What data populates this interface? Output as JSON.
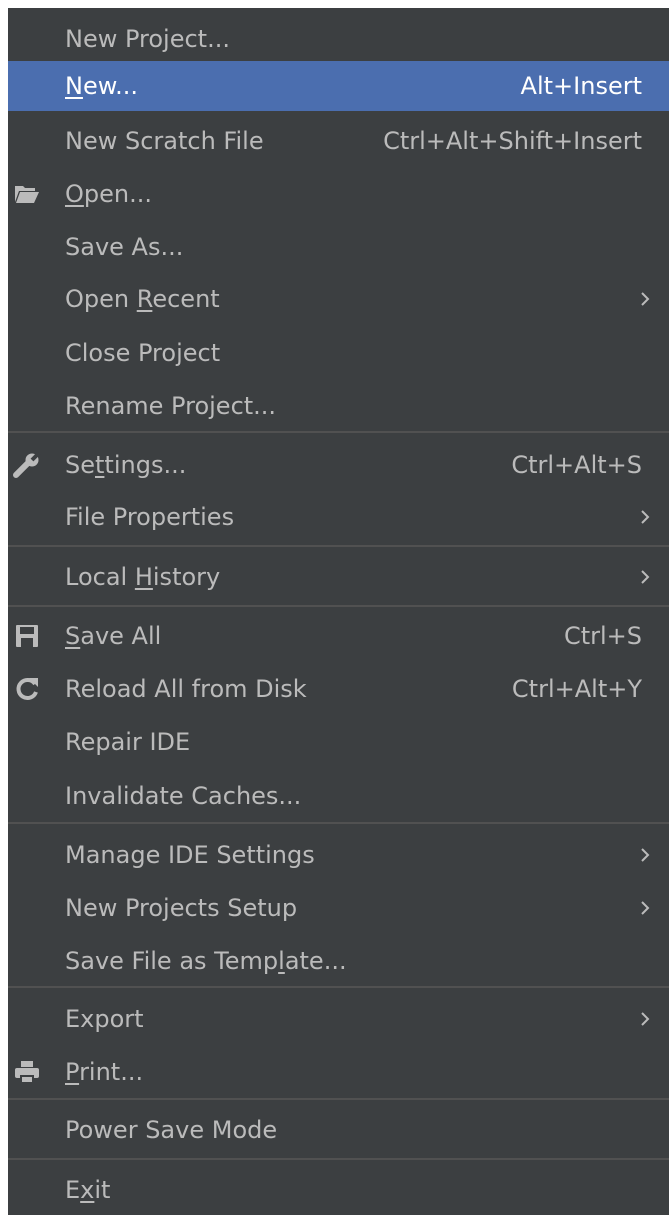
{
  "menu": {
    "items": [
      {
        "id": "new-project",
        "pre": "New Project...",
        "mn": "",
        "post": "",
        "shortcut": "",
        "submenu": false
      },
      {
        "id": "new",
        "pre": "",
        "mn": "N",
        "post": "ew...",
        "shortcut": "Alt+Insert",
        "submenu": false,
        "selected": true
      },
      {
        "id": "new-scratch-file",
        "pre": "New Scratch File",
        "mn": "",
        "post": "",
        "shortcut": "Ctrl+Alt+Shift+Insert",
        "submenu": false
      },
      {
        "id": "open",
        "pre": "",
        "mn": "O",
        "post": "pen...",
        "shortcut": "",
        "submenu": false,
        "icon": "folder-open-icon"
      },
      {
        "id": "save-as",
        "pre": "Save As...",
        "mn": "",
        "post": "",
        "shortcut": "",
        "submenu": false
      },
      {
        "id": "open-recent",
        "pre": "Open ",
        "mn": "R",
        "post": "ecent",
        "shortcut": "",
        "submenu": true
      },
      {
        "id": "close-project",
        "pre": "Close Project",
        "mn": "",
        "post": "",
        "shortcut": "",
        "submenu": false
      },
      {
        "id": "rename-project",
        "pre": "Rename Project...",
        "mn": "",
        "post": "",
        "shortcut": "",
        "submenu": false
      },
      {
        "id": "settings",
        "pre": "Se",
        "mn": "t",
        "post": "tings...",
        "shortcut": "Ctrl+Alt+S",
        "submenu": false,
        "icon": "wrench-icon"
      },
      {
        "id": "file-properties",
        "pre": "File Properties",
        "mn": "",
        "post": "",
        "shortcut": "",
        "submenu": true
      },
      {
        "id": "local-history",
        "pre": "Local ",
        "mn": "H",
        "post": "istory",
        "shortcut": "",
        "submenu": true
      },
      {
        "id": "save-all",
        "pre": "",
        "mn": "S",
        "post": "ave All",
        "shortcut": "Ctrl+S",
        "submenu": false,
        "icon": "floppy-disk-icon"
      },
      {
        "id": "reload-all",
        "pre": "Reload All from Disk",
        "mn": "",
        "post": "",
        "shortcut": "Ctrl+Alt+Y",
        "submenu": false,
        "icon": "refresh-icon"
      },
      {
        "id": "repair-ide",
        "pre": "Repair IDE",
        "mn": "",
        "post": "",
        "shortcut": "",
        "submenu": false
      },
      {
        "id": "invalidate-caches",
        "pre": "Invalidate Caches...",
        "mn": "",
        "post": "",
        "shortcut": "",
        "submenu": false
      },
      {
        "id": "manage-ide-settings",
        "pre": "Manage IDE Settings",
        "mn": "",
        "post": "",
        "shortcut": "",
        "submenu": true
      },
      {
        "id": "new-projects-setup",
        "pre": "New Projects Setup",
        "mn": "",
        "post": "",
        "shortcut": "",
        "submenu": true
      },
      {
        "id": "save-file-as-template",
        "pre": "Save File as Temp",
        "mn": "l",
        "post": "ate...",
        "shortcut": "",
        "submenu": false
      },
      {
        "id": "export",
        "pre": "Export",
        "mn": "",
        "post": "",
        "shortcut": "",
        "submenu": true
      },
      {
        "id": "print",
        "pre": "",
        "mn": "P",
        "post": "rint...",
        "shortcut": "",
        "submenu": false,
        "icon": "printer-icon"
      },
      {
        "id": "power-save-mode",
        "pre": "Power Save Mode",
        "mn": "",
        "post": "",
        "shortcut": "",
        "submenu": false
      },
      {
        "id": "exit",
        "pre": "E",
        "mn": "x",
        "post": "it",
        "shortcut": "",
        "submenu": false
      }
    ]
  },
  "colors": {
    "background": "#3c3f41",
    "selection": "#4b6eaf",
    "text": "#bbbbbb",
    "separator": "#515151"
  }
}
